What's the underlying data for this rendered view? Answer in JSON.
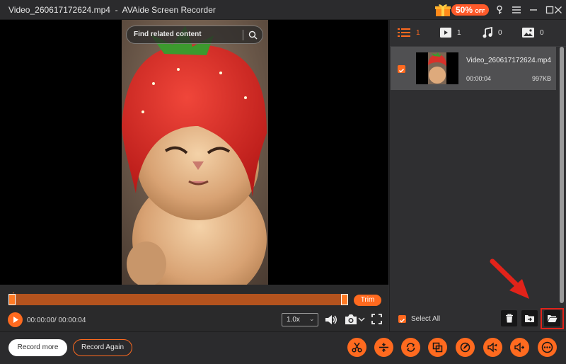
{
  "window": {
    "title": "Video_260617172624.mp4  -  AVAide Screen Recorder",
    "promo": {
      "percent": "50%",
      "suffix": "OFF"
    },
    "colors": {
      "accent": "#ff6a1f",
      "bg": "#2f2f31",
      "highlight": "#e2231a"
    }
  },
  "player": {
    "search_placeholder": "Find related content",
    "trim_label": "Trim",
    "time": "00:00:00/ 00:00:04",
    "speed": "1.0x"
  },
  "panel": {
    "tabs": [
      {
        "icon": "list-icon",
        "count": "1"
      },
      {
        "icon": "video-icon",
        "count": "1"
      },
      {
        "icon": "music-note-icon",
        "count": "0"
      },
      {
        "icon": "image-icon",
        "count": "0"
      }
    ],
    "item": {
      "name": "Video_260617172624.mp4",
      "duration": "00:00:04",
      "size": "997KB"
    },
    "select_all_label": "Select All"
  },
  "bottom": {
    "record_more": "Record more",
    "record_again": "Record Again",
    "tools": [
      "scissors-icon",
      "merge-icon",
      "convert-icon",
      "compress-icon",
      "edit-metadata-icon",
      "audio-convert-icon",
      "volume-boost-icon",
      "more-icon"
    ]
  }
}
